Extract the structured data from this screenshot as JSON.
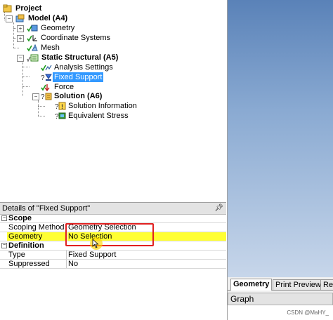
{
  "tree": {
    "project": "Project",
    "model": "Model (A4)",
    "geometry": "Geometry",
    "coordinate_systems": "Coordinate Systems",
    "mesh": "Mesh",
    "static_structural": "Static Structural (A5)",
    "analysis_settings": "Analysis Settings",
    "fixed_support": "Fixed Support",
    "force": "Force",
    "solution": "Solution (A6)",
    "solution_information": "Solution Information",
    "equivalent_stress": "Equivalent Stress"
  },
  "details": {
    "title": "Details of \"Fixed Support\"",
    "scope_section": "Scope",
    "scoping_method_label": "Scoping Method",
    "scoping_method_value": "Geometry Selection",
    "geometry_label": "Geometry",
    "geometry_value": "No Selection",
    "definition_section": "Definition",
    "type_label": "Type",
    "type_value": "Fixed Support",
    "suppressed_label": "Suppressed",
    "suppressed_value": "No"
  },
  "tabs": {
    "geometry": "Geometry",
    "print_preview": "Print Preview",
    "report": "Re"
  },
  "graph": {
    "title": "Graph",
    "watermark": "CSDN @MaHY_"
  },
  "colors": {
    "selection": "#3399ff",
    "highlight": "#ffff33",
    "annotation": "#e02020"
  }
}
